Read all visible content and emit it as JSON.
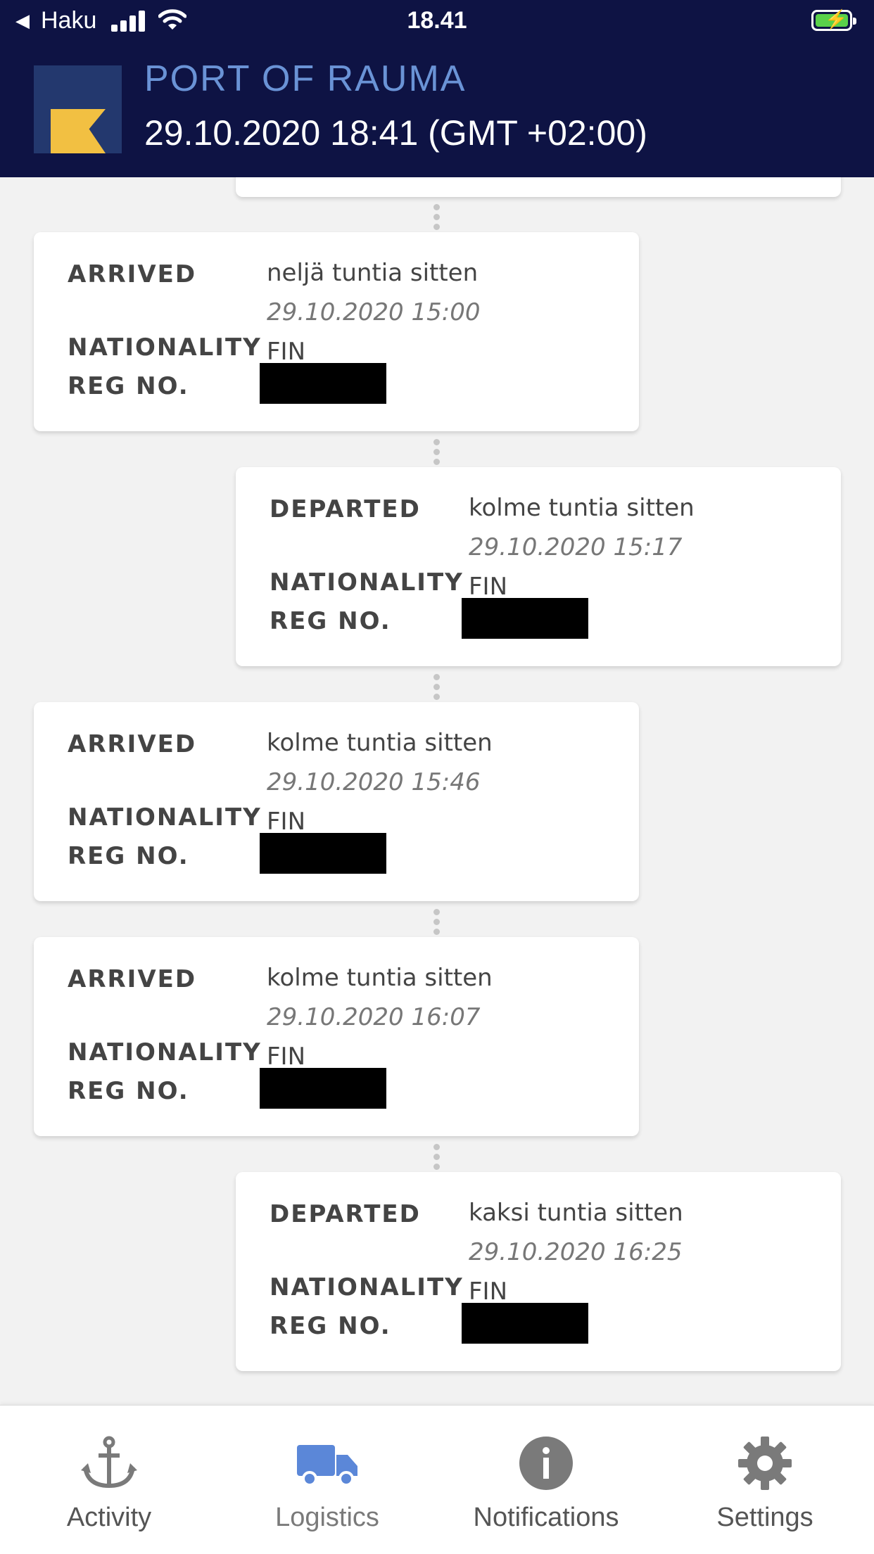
{
  "status_bar": {
    "back_label": "Haku",
    "time": "18.41",
    "icons": [
      "back-arrow-icon",
      "signal-bars-icon",
      "wifi-icon",
      "battery-charging-icon"
    ]
  },
  "header": {
    "title": "PORT OF RAUMA",
    "datetime": "29.10.2020 18:41 (GMT +02:00)",
    "logo_colors": {
      "background": "#23386e",
      "mark": "#f2c042"
    }
  },
  "timeline": {
    "labels": {
      "nationality": "NATIONALITY",
      "reg_no": "REG NO."
    },
    "events": [
      {
        "status": "ARRIVED",
        "relative": "neljä tuntia sitten",
        "timestamp": "29.10.2020 15:00",
        "nationality": "FIN",
        "reg_no": ""
      },
      {
        "status": "DEPARTED",
        "relative": "kolme tuntia sitten",
        "timestamp": "29.10.2020 15:17",
        "nationality": "FIN",
        "reg_no": ""
      },
      {
        "status": "ARRIVED",
        "relative": "kolme tuntia sitten",
        "timestamp": "29.10.2020 15:46",
        "nationality": "FIN",
        "reg_no": ""
      },
      {
        "status": "ARRIVED",
        "relative": "kolme tuntia sitten",
        "timestamp": "29.10.2020 16:07",
        "nationality": "FIN",
        "reg_no": ""
      },
      {
        "status": "DEPARTED",
        "relative": "kaksi tuntia sitten",
        "timestamp": "29.10.2020 16:25",
        "nationality": "FIN",
        "reg_no": ""
      }
    ]
  },
  "bottom_nav": {
    "active": "Logistics",
    "active_color": "#5b87d8",
    "inactive_color": "#7a7a7a",
    "items": [
      {
        "label": "Activity",
        "icon": "anchor-icon"
      },
      {
        "label": "Logistics",
        "icon": "truck-icon"
      },
      {
        "label": "Notifications",
        "icon": "info-icon"
      },
      {
        "label": "Settings",
        "icon": "gear-icon"
      }
    ]
  }
}
